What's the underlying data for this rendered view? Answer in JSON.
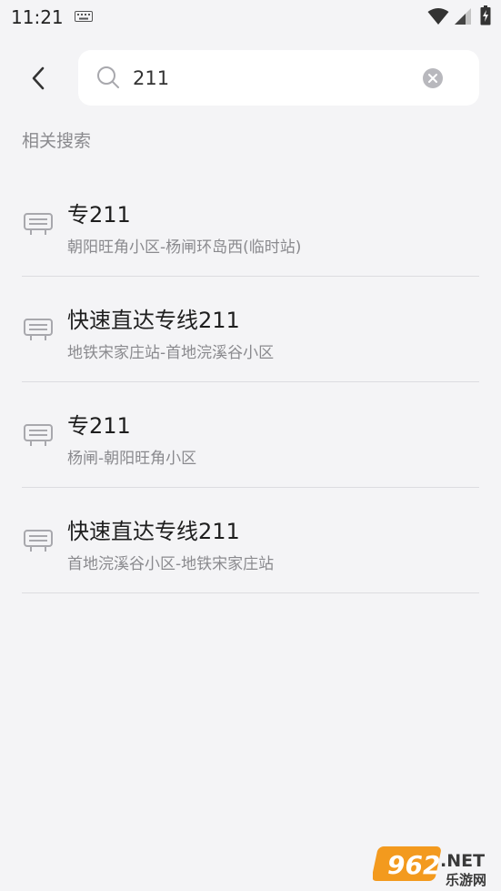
{
  "status_bar": {
    "time": "11:21"
  },
  "search": {
    "query": "211"
  },
  "section_title": "相关搜索",
  "results": [
    {
      "name": "专211",
      "route": "朝阳旺角小区-杨闸环岛西(临时站)"
    },
    {
      "name": "快速直达专线211",
      "route": "地铁宋家庄站-首地浣溪谷小区"
    },
    {
      "name": "专211",
      "route": "杨闸-朝阳旺角小区"
    },
    {
      "name": "快速直达专线211",
      "route": "首地浣溪谷小区-地铁宋家庄站"
    }
  ],
  "watermark": {
    "brand": "962",
    "suffix": ".NET",
    "tagline": "乐游网"
  },
  "colors": {
    "background": "#f4f4f6",
    "icon": "#a8a8ad",
    "divider": "#dcdce0",
    "watermark_orange": "#f39a1e"
  }
}
